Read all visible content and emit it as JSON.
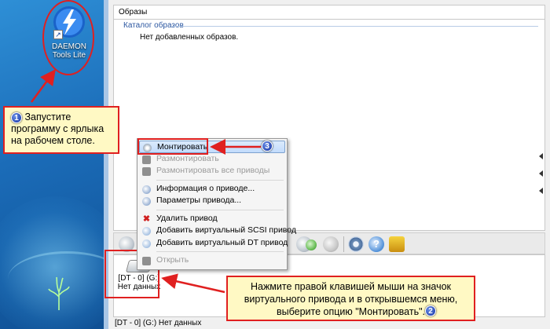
{
  "desktop": {
    "icon_label": "DAEMON Tools Lite"
  },
  "callouts": {
    "step1_number": "1",
    "step1_text": "Запустите программу с ярлыка на рабочем столе.",
    "step2_number": "2",
    "step2_text": "Нажмите правой клавишей мыши на значок виртуального привода и в открывшемся меню, выберите опцию \"Монтировать\".",
    "step3_number": "3"
  },
  "window": {
    "images_header": "Образы",
    "catalog_title": "Каталог образов",
    "catalog_empty": "Нет добавленных образов.",
    "drive_name": "[DT - 0] (G:)",
    "drive_status": "Нет данных",
    "statusbar": "[DT - 0] (G:) Нет данных",
    "help_glyph": "?"
  },
  "context_menu": {
    "items": [
      {
        "label": "Монтировать",
        "state": "highlighted",
        "icon": "disc-icon"
      },
      {
        "label": "Размонтировать",
        "state": "disabled",
        "icon": "unmount-icon"
      },
      {
        "label": "Размонтировать все приводы",
        "state": "disabled",
        "icon": "unmount-all-icon"
      },
      {
        "label": "Информация о приводе...",
        "state": "enabled",
        "icon": "info-icon"
      },
      {
        "label": "Параметры привода...",
        "state": "enabled",
        "icon": "params-icon"
      },
      {
        "label": "Удалить привод",
        "state": "enabled",
        "icon": "delete-icon"
      },
      {
        "label": "Добавить виртуальный SCSI привод",
        "state": "enabled",
        "icon": "add-scsi-icon"
      },
      {
        "label": "Добавить виртуальный DT привод",
        "state": "enabled",
        "icon": "add-dt-icon"
      },
      {
        "label": "Открыть",
        "state": "disabled",
        "icon": "open-icon"
      }
    ],
    "delete_glyph": "✖"
  },
  "colors": {
    "annotation_red": "#e02020",
    "callout_bg": "#fff9c4",
    "arrow_blue": "#1a3fbf"
  }
}
